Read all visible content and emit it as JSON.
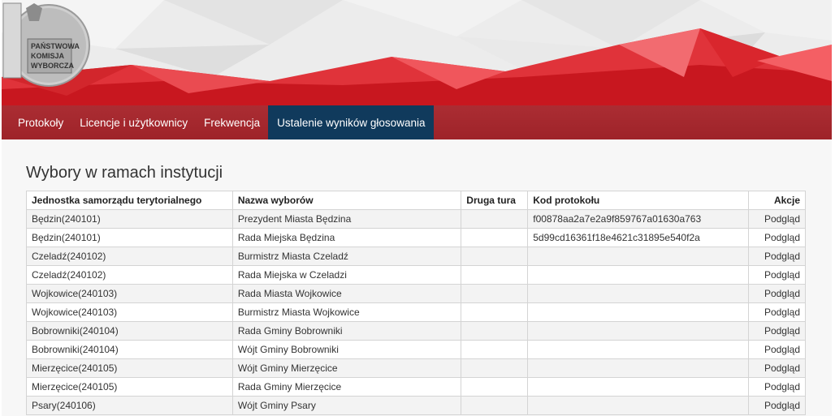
{
  "logo": {
    "text_lines": [
      "PAŃSTWOWA",
      "KOMISJA",
      "WYBORCZA"
    ]
  },
  "nav": {
    "items": [
      {
        "label": "Protokoły"
      },
      {
        "label": "Licencje i użytkownicy"
      },
      {
        "label": "Frekwencja"
      },
      {
        "label": "Ustalenie wyników głosowania"
      }
    ],
    "active_index": 3
  },
  "page_title": "Wybory w ramach instytucji",
  "table": {
    "headers": [
      "Jednostka samorządu terytorialnego",
      "Nazwa wyborów",
      "Druga tura",
      "Kod protokołu",
      "Akcje"
    ],
    "rows": [
      {
        "unit": "Będzin(240101)",
        "election": "Prezydent Miasta Będzina",
        "second_round": "",
        "code": "f00878aa2a7e2a9f859767a01630a763",
        "action": "Podgląd"
      },
      {
        "unit": "Będzin(240101)",
        "election": "Rada Miejska Będzina",
        "second_round": "",
        "code": "5d99cd16361f18e4621c31895e540f2a",
        "action": "Podgląd"
      },
      {
        "unit": "Czeladź(240102)",
        "election": "Burmistrz Miasta Czeladź",
        "second_round": "",
        "code": "",
        "action": "Podgląd"
      },
      {
        "unit": "Czeladź(240102)",
        "election": "Rada Miejska w Czeladzi",
        "second_round": "",
        "code": "",
        "action": "Podgląd"
      },
      {
        "unit": "Wojkowice(240103)",
        "election": "Rada Miasta Wojkowice",
        "second_round": "",
        "code": "",
        "action": "Podgląd"
      },
      {
        "unit": "Wojkowice(240103)",
        "election": "Burmistrz Miasta Wojkowice",
        "second_round": "",
        "code": "",
        "action": "Podgląd"
      },
      {
        "unit": "Bobrowniki(240104)",
        "election": "Rada Gminy Bobrowniki",
        "second_round": "",
        "code": "",
        "action": "Podgląd"
      },
      {
        "unit": "Bobrowniki(240104)",
        "election": "Wójt Gminy Bobrowniki",
        "second_round": "",
        "code": "",
        "action": "Podgląd"
      },
      {
        "unit": "Mierzęcice(240105)",
        "election": "Wójt Gminy Mierzęcice",
        "second_round": "",
        "code": "",
        "action": "Podgląd"
      },
      {
        "unit": "Mierzęcice(240105)",
        "election": "Rada Gminy Mierzęcice",
        "second_round": "",
        "code": "",
        "action": "Podgląd"
      },
      {
        "unit": "Psary(240106)",
        "election": "Wójt Gminy Psary",
        "second_round": "",
        "code": "",
        "action": "Podgląd"
      }
    ]
  },
  "colors": {
    "nav_bg": "#a3282e",
    "nav_active": "#103a5c",
    "banner_red": "#d7222a"
  }
}
